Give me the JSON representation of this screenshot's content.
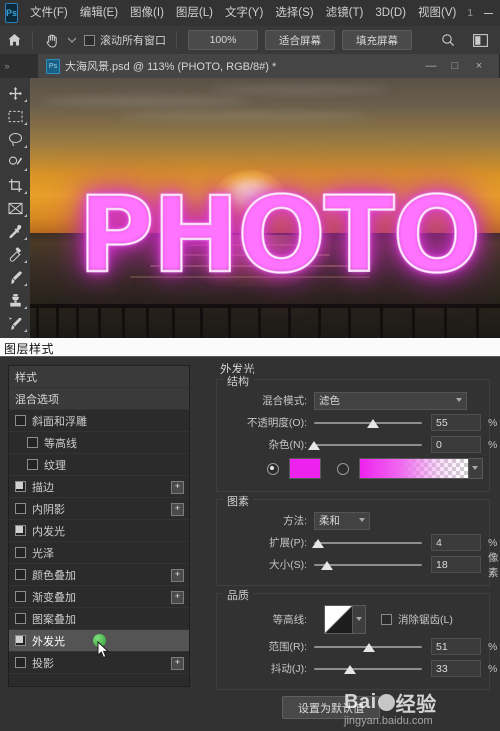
{
  "app": {
    "name": "Ps",
    "logo_color": "#2c7fb8"
  },
  "menubar": {
    "items": [
      {
        "label": "文件(F)"
      },
      {
        "label": "编辑(E)"
      },
      {
        "label": "图像(I)"
      },
      {
        "label": "图层(L)"
      },
      {
        "label": "文字(Y)"
      },
      {
        "label": "选择(S)"
      },
      {
        "label": "滤镜(T)"
      },
      {
        "label": "3D(D)"
      },
      {
        "label": "视图(V)"
      }
    ],
    "trailing_number": "1",
    "window_buttons": {
      "minimize": "minimize-icon",
      "maximize": "maximize-icon"
    }
  },
  "options_bar": {
    "home_icon": "home-icon",
    "tool_icon": "hand-tool-icon",
    "tool_dropdown": "chevron-down-icon",
    "scroll_all_windows": {
      "label": "滚动所有窗口",
      "checked": false
    },
    "buttons": [
      {
        "label": "100%"
      },
      {
        "label": "适合屏幕"
      },
      {
        "label": "填充屏幕"
      }
    ],
    "search_icon": "search-icon",
    "workspace_icon": "workspace-panel-icon"
  },
  "document_tab": {
    "overflow_icon": "chevron-double-right-icon",
    "file_icon": "psd-file-icon",
    "title": "大海风景.psd @ 113% (PHOTO, RGB/8#) *",
    "window_buttons": {
      "minimize": "—",
      "restore": "□",
      "close": "×"
    }
  },
  "tools": [
    {
      "name": "move-tool",
      "icon": "move-icon"
    },
    {
      "name": "marquee-tool",
      "icon": "rectangular-marquee-icon"
    },
    {
      "name": "lasso-tool",
      "icon": "lasso-icon"
    },
    {
      "name": "quick-selection-tool",
      "icon": "quick-selection-icon"
    },
    {
      "name": "crop-tool",
      "icon": "crop-icon"
    },
    {
      "name": "frame-tool",
      "icon": "frame-icon"
    },
    {
      "name": "eyedropper-tool",
      "icon": "eyedropper-icon"
    },
    {
      "name": "spot-healing-tool",
      "icon": "healing-brush-icon"
    },
    {
      "name": "brush-tool",
      "icon": "brush-icon"
    },
    {
      "name": "clone-stamp-tool",
      "icon": "clone-stamp-icon"
    },
    {
      "name": "history-brush-tool",
      "icon": "history-brush-icon"
    }
  ],
  "canvas": {
    "artwork_text": "PHOTO",
    "zoom": "113%"
  },
  "dialog": {
    "title": "图层样式",
    "styles_panel": {
      "items": [
        {
          "label": "样式",
          "type": "header",
          "checkbox": false,
          "checked": false,
          "plus": false,
          "selected": false
        },
        {
          "label": "混合选项",
          "type": "header",
          "checkbox": false,
          "checked": false,
          "plus": false,
          "selected": false
        },
        {
          "label": "斜面和浮雕",
          "type": "normal",
          "checkbox": true,
          "checked": false,
          "plus": false,
          "selected": false
        },
        {
          "label": "等高线",
          "type": "sub",
          "checkbox": true,
          "checked": false,
          "plus": false,
          "selected": false
        },
        {
          "label": "纹理",
          "type": "sub",
          "checkbox": true,
          "checked": false,
          "plus": false,
          "selected": false
        },
        {
          "label": "描边",
          "type": "normal",
          "checkbox": true,
          "checked": true,
          "plus": true,
          "selected": false
        },
        {
          "label": "内阴影",
          "type": "normal",
          "checkbox": true,
          "checked": false,
          "plus": true,
          "selected": false
        },
        {
          "label": "内发光",
          "type": "normal",
          "checkbox": true,
          "checked": true,
          "plus": false,
          "selected": false
        },
        {
          "label": "光泽",
          "type": "normal",
          "checkbox": true,
          "checked": false,
          "plus": false,
          "selected": false
        },
        {
          "label": "颜色叠加",
          "type": "normal",
          "checkbox": true,
          "checked": false,
          "plus": true,
          "selected": false
        },
        {
          "label": "渐变叠加",
          "type": "normal",
          "checkbox": true,
          "checked": false,
          "plus": true,
          "selected": false
        },
        {
          "label": "图案叠加",
          "type": "normal",
          "checkbox": true,
          "checked": false,
          "plus": false,
          "selected": false
        },
        {
          "label": "外发光",
          "type": "normal",
          "checkbox": true,
          "checked": true,
          "plus": false,
          "selected": true
        },
        {
          "label": "投影",
          "type": "normal",
          "checkbox": true,
          "checked": false,
          "plus": true,
          "selected": false
        }
      ],
      "plus_label": "+",
      "cursor_icon": "mouse-pointer-icon",
      "highlight_dot_color": "#45a845"
    },
    "settings": {
      "effect_title": "外发光",
      "structure": {
        "group_label": "结构",
        "blend_mode": {
          "label": "混合模式:",
          "value": "滤色"
        },
        "opacity": {
          "label": "不透明度(O):",
          "value": "55",
          "unit": "%",
          "percent": 55
        },
        "noise": {
          "label": "杂色(N):",
          "value": "0",
          "unit": "%",
          "percent": 0
        },
        "color_mode": {
          "solid_selected": true,
          "color": "#ee22ee",
          "gradient_selected": false
        }
      },
      "elements": {
        "group_label": "图素",
        "technique": {
          "label": "方法:",
          "value": "柔和"
        },
        "spread": {
          "label": "扩展(P):",
          "value": "4",
          "unit": "%",
          "percent": 4
        },
        "size": {
          "label": "大小(S):",
          "value": "18",
          "unit": "像素",
          "percent": 12
        }
      },
      "quality": {
        "group_label": "品质",
        "contour": {
          "label": "等高线:",
          "icon": "contour-thumbnail-icon"
        },
        "anti_alias": {
          "label": "消除锯齿(L)",
          "checked": false
        },
        "range": {
          "label": "范围(R):",
          "value": "51",
          "unit": "%",
          "percent": 51
        },
        "jitter": {
          "label": "抖动(J):",
          "value": "33",
          "unit": "%",
          "percent": 33
        }
      }
    },
    "default_button": "设置为默认值"
  },
  "watermark": {
    "brand": "Bai",
    "brand2": "du",
    "suffix": "经验",
    "url": "jingyan.baidu.com"
  }
}
